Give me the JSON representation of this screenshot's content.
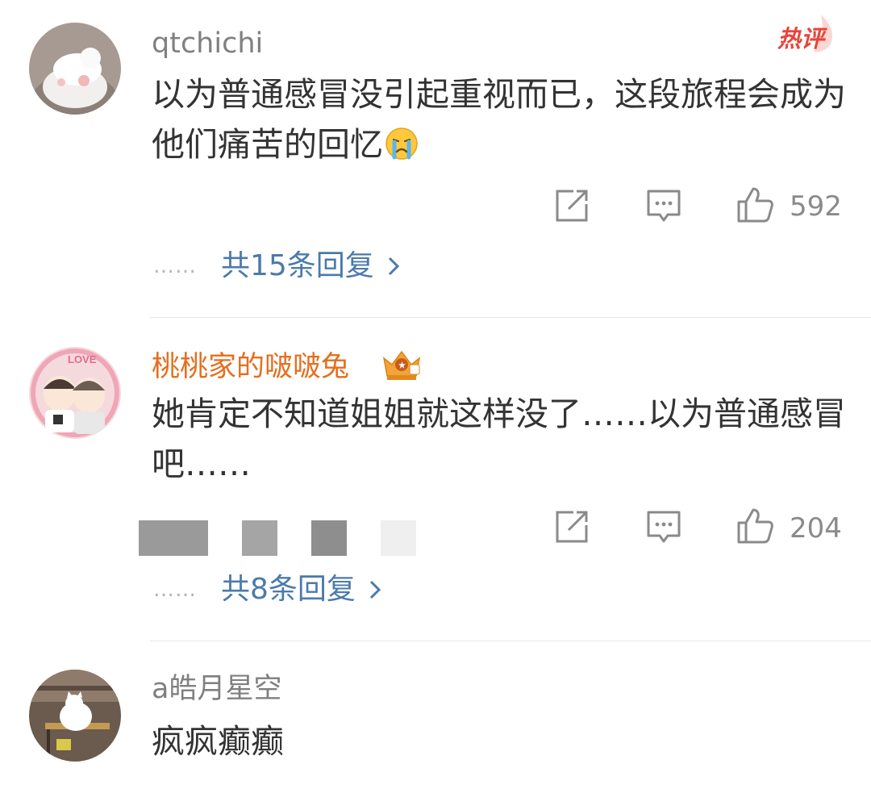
{
  "comments": [
    {
      "username": "qtchichi",
      "text": "以为普通感冒没引起重视而已，这段旅程会成为他们痛苦的回忆",
      "emoji": "crying-emoji",
      "badge": "热评",
      "likes": "592",
      "reply_label": "共15条回复",
      "reply_dots": "……"
    },
    {
      "username": "桃桃家的啵啵兔",
      "text": "她肯定不知道姐姐就这样没了……以为普通感冒吧……",
      "likes": "204",
      "reply_label": "共8条回复",
      "reply_dots": "……",
      "avatar_text": "LOVE"
    },
    {
      "username": "a皓月星空",
      "text": "疯疯癫癫"
    }
  ],
  "colors": {
    "username": "#808080",
    "vip_username": "#e46f1f",
    "text": "#333333",
    "link": "#4c7aaa",
    "hot": "#e8443a",
    "icon": "#8a8a8a"
  }
}
